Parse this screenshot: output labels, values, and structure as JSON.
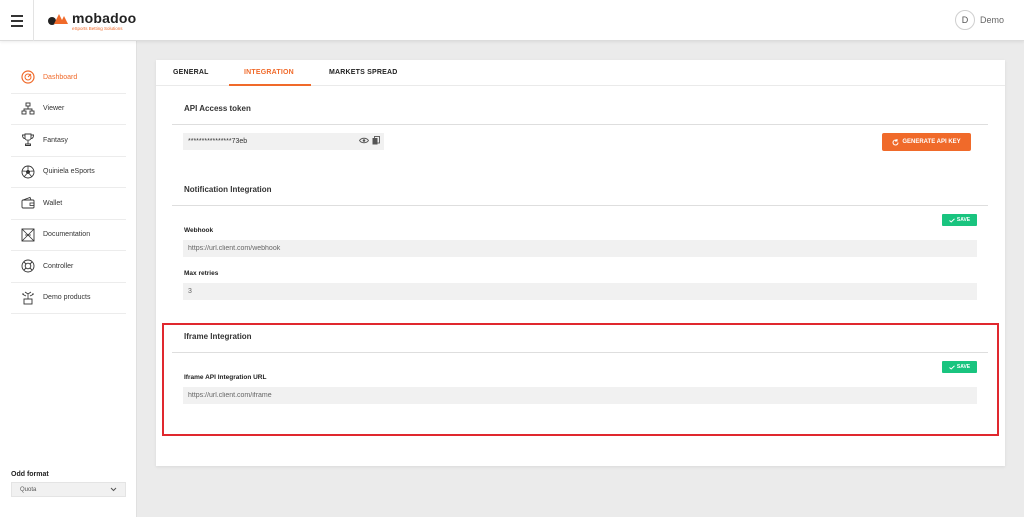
{
  "header": {
    "brand": {
      "name": "mobadoo",
      "tagline": "eSports Betting Solutions"
    },
    "user": {
      "initial": "D",
      "name": "Demo"
    }
  },
  "sidebar": {
    "items": [
      {
        "label": "Dashboard",
        "icon": "dashboard-icon",
        "active": true
      },
      {
        "label": "Viewer",
        "icon": "viewer-icon"
      },
      {
        "label": "Fantasy",
        "icon": "trophy-icon"
      },
      {
        "label": "Quiniela eSports",
        "icon": "ball-icon"
      },
      {
        "label": "Wallet",
        "icon": "wallet-icon"
      },
      {
        "label": "Documentation",
        "icon": "documentation-icon"
      },
      {
        "label": "Controller",
        "icon": "lifebuoy-icon"
      },
      {
        "label": "Demo products",
        "icon": "demo-products-icon"
      }
    ],
    "odd_format": {
      "label": "Odd format",
      "value": "Quota"
    }
  },
  "tabs": [
    {
      "label": "GENERAL"
    },
    {
      "label": "INTEGRATION",
      "active": true
    },
    {
      "label": "MARKETS SPREAD"
    }
  ],
  "api": {
    "title": "API Access token",
    "token": "****************73eb",
    "generate_label": "GENERATE API KEY"
  },
  "notification": {
    "title": "Notification Integration",
    "save_label": "SAVE",
    "webhook_label": "Webhook",
    "webhook_value": "https://url.client.com/webhook",
    "retries_label": "Max retries",
    "retries_value": "3"
  },
  "iframe": {
    "title": "Iframe Integration",
    "save_label": "SAVE",
    "url_label": "Iframe API Integration URL",
    "url_value": "https://url.client.com/iframe"
  },
  "colors": {
    "accent": "#f06a2a",
    "save": "#19c47f",
    "highlight": "#e0282e"
  }
}
